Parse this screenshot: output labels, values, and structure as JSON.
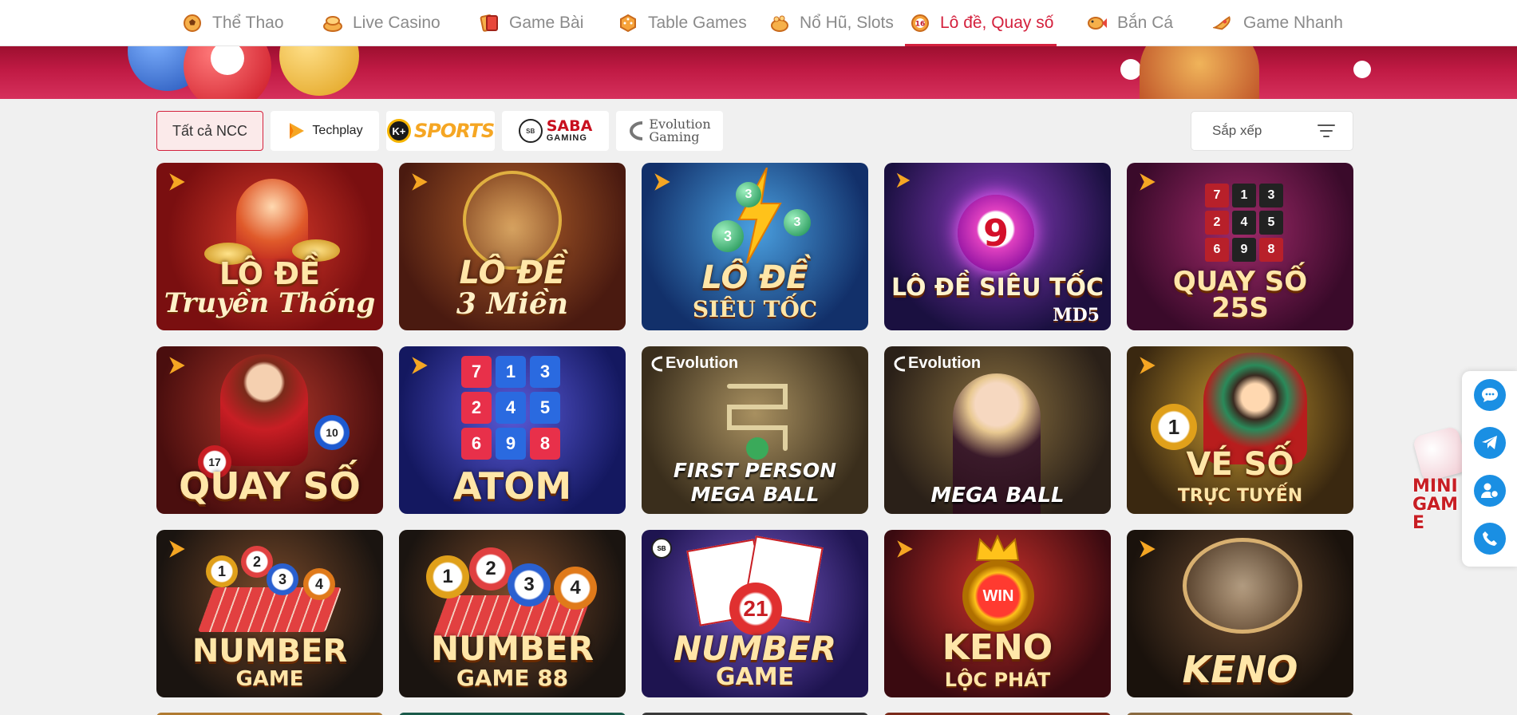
{
  "nav": {
    "items": [
      {
        "label": "Thể Thao",
        "icon": "soccer-ball-icon"
      },
      {
        "label": "Live Casino",
        "icon": "casino-chips-icon"
      },
      {
        "label": "Game Bài",
        "icon": "playing-cards-icon"
      },
      {
        "label": "Table Games",
        "icon": "dice-icon"
      },
      {
        "label": "Nổ Hũ, Slots",
        "icon": "jackpot-pot-icon"
      },
      {
        "label": "Lô đề, Quay số",
        "icon": "lottery-ball-icon",
        "active": true
      },
      {
        "label": "Bắn Cá",
        "icon": "fish-icon"
      },
      {
        "label": "Game Nhanh",
        "icon": "rocket-icon"
      }
    ],
    "active_color": "#d4213d"
  },
  "filters": {
    "all_label": "Tất cả NCC",
    "providers": [
      {
        "label": "Techplay",
        "icon": "techplay-logo"
      },
      {
        "label": "SPORTS",
        "icon": "k-sports-logo"
      },
      {
        "label": "SABA",
        "sub": "GAMING",
        "icon": "saba-gaming-logo"
      },
      {
        "label": "Evolution",
        "sub": "Gaming",
        "icon": "evolution-gaming-logo"
      }
    ],
    "sort_label": "Sắp xếp"
  },
  "games": [
    {
      "title": "LÔ ĐỀ",
      "subtitle": "Truyền Thống",
      "provider": "techplay"
    },
    {
      "title": "LÔ ĐỀ",
      "subtitle": "3 Miền",
      "provider": "techplay"
    },
    {
      "title": "LÔ ĐỀ",
      "subtitle": "SIÊU TỐC",
      "provider": "techplay",
      "balls": [
        "3",
        "3",
        "3"
      ]
    },
    {
      "title": "LÔ ĐỀ SIÊU TỐC",
      "subtitle": "MD5",
      "provider": "techplay",
      "balls": [
        "9"
      ]
    },
    {
      "title": "QUAY SỐ",
      "subtitle": "25S",
      "provider": "techplay",
      "balls": [
        "7",
        "1",
        "3",
        "2",
        "4",
        "5",
        "6",
        "9",
        "8"
      ]
    },
    {
      "title": "QUAY SỐ",
      "subtitle": "",
      "provider": "techplay",
      "balls": [
        "10",
        "17"
      ]
    },
    {
      "title": "ATOM",
      "subtitle": "",
      "provider": "techplay",
      "balls": [
        "7",
        "1",
        "3",
        "2",
        "4",
        "5",
        "6",
        "9",
        "8"
      ]
    },
    {
      "title": "FIRST PERSON",
      "subtitle": "MEGA BALL",
      "provider": "evolution",
      "provider_label": "Evolution"
    },
    {
      "title": "MEGA BALL",
      "subtitle": "",
      "provider": "evolution",
      "provider_label": "Evolution"
    },
    {
      "title": "VÉ SỐ",
      "subtitle": "TRỰC TUYẾN",
      "provider": "techplay",
      "balls": [
        "1"
      ]
    },
    {
      "title": "NUMBER",
      "subtitle": "GAME",
      "provider": "techplay",
      "balls": [
        "1",
        "2",
        "3",
        "4"
      ]
    },
    {
      "title": "NUMBER",
      "subtitle": "GAME 88",
      "provider": "techplay",
      "balls": [
        "1",
        "2",
        "3",
        "4"
      ]
    },
    {
      "title": "NUMBER",
      "subtitle": "GAME",
      "provider": "saba",
      "balls": [
        "21"
      ]
    },
    {
      "title": "KENO",
      "subtitle": "LỘC PHÁT",
      "provider": "techplay",
      "badge": "WIN"
    },
    {
      "title": "KENO",
      "subtitle": "",
      "provider": "techplay"
    }
  ],
  "contacts": [
    {
      "icon": "chat-icon"
    },
    {
      "icon": "telegram-icon"
    },
    {
      "icon": "user-support-icon"
    },
    {
      "icon": "phone-icon"
    }
  ],
  "mini_game": {
    "label": "MINI GAME"
  }
}
